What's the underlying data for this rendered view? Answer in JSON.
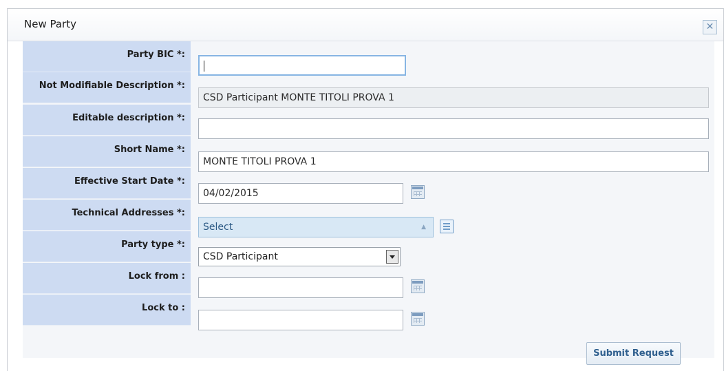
{
  "dialog": {
    "title": "New Party",
    "close_icon": "close-icon"
  },
  "fields": {
    "party_bic": {
      "label": "Party BIC *:",
      "value": ""
    },
    "not_modifiable_description": {
      "label": "Not Modifiable Description *:",
      "value": "CSD Participant MONTE TITOLI PROVA 1"
    },
    "editable_description": {
      "label": "Editable description *:",
      "value": ""
    },
    "short_name": {
      "label": "Short Name *:",
      "value": "MONTE TITOLI PROVA 1"
    },
    "effective_start_date": {
      "label": "Effective Start Date *:",
      "value": "04/02/2015"
    },
    "technical_addresses": {
      "label": "Technical Addresses *:",
      "value": "Select"
    },
    "party_type": {
      "label": "Party type *:",
      "value": "CSD Participant"
    },
    "lock_from": {
      "label": "Lock from :",
      "value": ""
    },
    "lock_to": {
      "label": "Lock to :",
      "value": ""
    }
  },
  "actions": {
    "submit_label": "Submit Request"
  },
  "colors": {
    "label_background": "#cddbf2",
    "form_background": "#f4f6f9",
    "select_background": "#d8e8f5",
    "accent": "#2f5f8e"
  },
  "icons": [
    "close-icon",
    "calendar-icon",
    "list-icon",
    "dropdown-arrow-icon"
  ]
}
